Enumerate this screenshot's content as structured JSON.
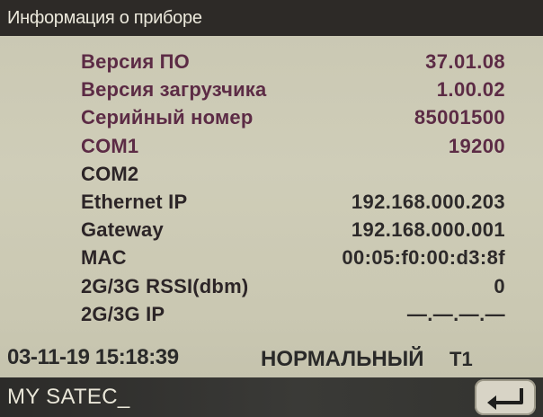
{
  "header": {
    "title": "Информация о приборе"
  },
  "colors": {
    "label": "#5c2b45",
    "value": "#5c2b45",
    "label_dark": "#2c2527",
    "value_dark": "#2d2a2a"
  },
  "info": {
    "rows": [
      {
        "label": "Версия ПО",
        "value": "37.01.08",
        "tone": "accent"
      },
      {
        "label": "Версия загрузчика",
        "value": "1.00.02",
        "tone": "accent"
      },
      {
        "label": "Серийный номер",
        "value": "85001500",
        "tone": "accent"
      },
      {
        "label": "COM1",
        "value": "19200",
        "tone": "accent"
      },
      {
        "label": "COM2",
        "value": "",
        "tone": "dark"
      },
      {
        "label": "Ethernet IP",
        "value": "192.168.000.203",
        "tone": "dark"
      },
      {
        "label": "Gateway",
        "value": "192.168.000.001",
        "tone": "dark"
      },
      {
        "label": "MAC",
        "value": "00:05:f0:00:d3:8f",
        "tone": "dark"
      },
      {
        "label": "2G/3G RSSI(dbm)",
        "value": "0",
        "tone": "dark"
      },
      {
        "label": "2G/3G IP",
        "value": "—.—.—.—",
        "tone": "dark"
      }
    ]
  },
  "status": {
    "datetime": "03-11-19 15:18:39",
    "mode": "НОРМАЛЬНЫЙ",
    "tariff": "T1"
  },
  "footer": {
    "device_name": "MY SATEC_",
    "back_icon": "back-arrow-icon"
  }
}
